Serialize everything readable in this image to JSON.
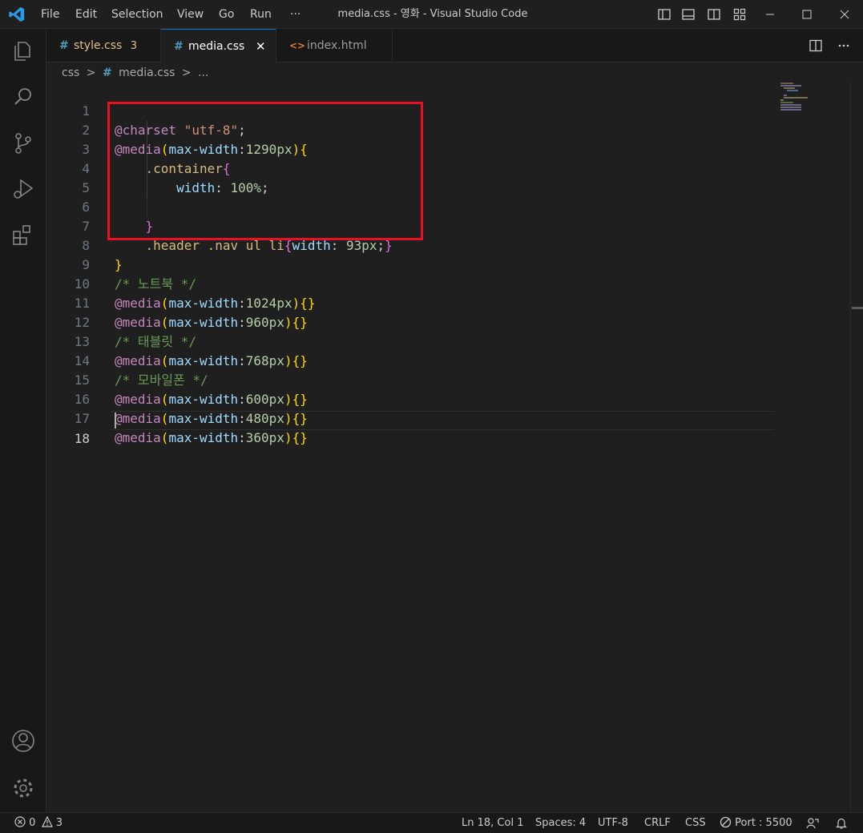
{
  "window": {
    "title": "media.css - 영화 - Visual Studio Code",
    "menu": [
      "File",
      "Edit",
      "Selection",
      "View",
      "Go",
      "Run",
      "···"
    ]
  },
  "tabs": [
    {
      "glyph": "#",
      "label": "style.css",
      "badge": "3",
      "color": "#e2c08d"
    },
    {
      "glyph": "#",
      "label": "media.css",
      "close": "✕",
      "color": "#ffffff"
    },
    {
      "glyph": "<>",
      "label": "index.html",
      "color": "#9d9d9d"
    }
  ],
  "breadcrumb": {
    "folder": "css",
    "sep": ">",
    "hash": "#",
    "file": "media.css",
    "more": "..."
  },
  "editor": {
    "lines": [
      "1",
      "2",
      "3",
      "4",
      "5",
      "6",
      "7",
      "8",
      "9",
      "10",
      "11",
      "12",
      "13",
      "14",
      "15",
      "16",
      "17",
      "18"
    ],
    "code": {
      "l1_at": "@charset",
      "l1_str": "\"utf-8\"",
      "l1_semi": ";",
      "media": "@media",
      "maxw": "max-width",
      "l2_val": "1290px",
      "l3_sel": ".container",
      "l4_prop": "width",
      "l4_val": "100%",
      "l7_sel": ".header .nav ul li",
      "l7_prop": "width",
      "l7_val": "93px",
      "l9_com": "/* 노트북 */",
      "l10_val": "1024px",
      "l11_val": "960px",
      "l12_com": "/* 태블릿 */",
      "l13_val": "768px",
      "l14_com": "/* 모바일폰 */",
      "l15_val": "600px",
      "l16_val": "480px",
      "l17_val": "360px"
    }
  },
  "status": {
    "errors": "0",
    "warnings": "3",
    "position": "Ln 18, Col 1",
    "spaces": "Spaces: 4",
    "encoding": "UTF-8",
    "eol": "CRLF",
    "language": "CSS",
    "port": "Port : 5500"
  },
  "icons": {
    "activity": [
      "explorer-icon",
      "search-icon",
      "source-control-icon",
      "run-debug-icon",
      "extensions-icon",
      "account-icon",
      "settings-gear-icon"
    ],
    "layout": [
      "toggle-sidebar-icon",
      "toggle-panel-icon",
      "toggle-secondary-sidebar-icon",
      "customize-layout-icon"
    ]
  },
  "colors": {
    "accent": "#0078d4",
    "highlight_box": "#e81123"
  }
}
